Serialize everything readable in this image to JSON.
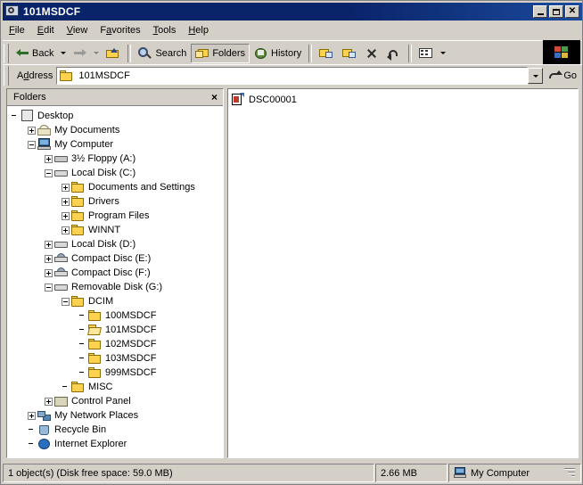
{
  "window": {
    "title": "101MSDCF",
    "title_icon": "folder-search-icon",
    "minimize_label": "Minimize",
    "maximize_label": "Maximize",
    "close_label": "Close"
  },
  "menubar": {
    "items": [
      {
        "label": "File",
        "accel": "F"
      },
      {
        "label": "Edit",
        "accel": "E"
      },
      {
        "label": "View",
        "accel": "V"
      },
      {
        "label": "Favorites",
        "accel": "a"
      },
      {
        "label": "Tools",
        "accel": "T"
      },
      {
        "label": "Help",
        "accel": "H"
      }
    ]
  },
  "toolbar": {
    "back_label": "Back",
    "forward_label": "Forward",
    "up_label": "Up",
    "search_label": "Search",
    "folders_label": "Folders",
    "history_label": "History",
    "move_to_label": "Move To",
    "copy_to_label": "Copy To",
    "delete_label": "Delete",
    "undo_label": "Undo",
    "views_label": "Views"
  },
  "address": {
    "label": "Address",
    "value": "101MSDCF",
    "icon": "folder-icon",
    "go_label": "Go"
  },
  "folders_pane": {
    "title": "Folders",
    "close_label": "×",
    "tree": [
      {
        "label": "Desktop",
        "indent": 0,
        "expander": "none",
        "icon": "desktop-icon"
      },
      {
        "label": "My Documents",
        "indent": 1,
        "expander": "plus",
        "icon": "my-documents-icon"
      },
      {
        "label": "My Computer",
        "indent": 1,
        "expander": "minus",
        "icon": "my-computer-icon"
      },
      {
        "label": "3½ Floppy (A:)",
        "indent": 2,
        "expander": "plus",
        "icon": "floppy-drive-icon"
      },
      {
        "label": "Local Disk (C:)",
        "indent": 2,
        "expander": "minus",
        "icon": "hard-drive-icon"
      },
      {
        "label": "Documents and Settings",
        "indent": 3,
        "expander": "plus",
        "icon": "folder-icon"
      },
      {
        "label": "Drivers",
        "indent": 3,
        "expander": "plus",
        "icon": "folder-icon"
      },
      {
        "label": "Program Files",
        "indent": 3,
        "expander": "plus",
        "icon": "folder-icon"
      },
      {
        "label": "WINNT",
        "indent": 3,
        "expander": "plus",
        "icon": "folder-icon"
      },
      {
        "label": "Local Disk (D:)",
        "indent": 2,
        "expander": "plus",
        "icon": "hard-drive-icon"
      },
      {
        "label": "Compact Disc (E:)",
        "indent": 2,
        "expander": "plus",
        "icon": "cd-drive-icon"
      },
      {
        "label": "Compact Disc (F:)",
        "indent": 2,
        "expander": "plus",
        "icon": "cd-drive-icon"
      },
      {
        "label": "Removable Disk (G:)",
        "indent": 2,
        "expander": "minus",
        "icon": "removable-drive-icon"
      },
      {
        "label": "DCIM",
        "indent": 3,
        "expander": "minus",
        "icon": "folder-icon"
      },
      {
        "label": "100MSDCF",
        "indent": 4,
        "expander": "none",
        "icon": "folder-icon"
      },
      {
        "label": "101MSDCF",
        "indent": 4,
        "expander": "none",
        "icon": "folder-open-icon"
      },
      {
        "label": "102MSDCF",
        "indent": 4,
        "expander": "none",
        "icon": "folder-icon"
      },
      {
        "label": "103MSDCF",
        "indent": 4,
        "expander": "none",
        "icon": "folder-icon"
      },
      {
        "label": "999MSDCF",
        "indent": 4,
        "expander": "none",
        "icon": "folder-icon"
      },
      {
        "label": "MISC",
        "indent": 3,
        "expander": "none",
        "icon": "folder-icon"
      },
      {
        "label": "Control Panel",
        "indent": 2,
        "expander": "plus",
        "icon": "control-panel-icon"
      },
      {
        "label": "My Network Places",
        "indent": 1,
        "expander": "plus",
        "icon": "network-places-icon"
      },
      {
        "label": "Recycle Bin",
        "indent": 1,
        "expander": "none",
        "icon": "recycle-bin-icon"
      },
      {
        "label": "Internet Explorer",
        "indent": 1,
        "expander": "none",
        "icon": "internet-explorer-icon"
      }
    ]
  },
  "list_pane": {
    "items": [
      {
        "label": "DSC00001",
        "icon": "image-file-icon"
      }
    ]
  },
  "statusbar": {
    "objects_text": "1 object(s) (Disk free space: 59.0 MB)",
    "size_text": "2.66 MB",
    "zone_text": "My Computer",
    "zone_icon": "my-computer-icon"
  },
  "colors": {
    "titlebar": "#0a246a",
    "chrome": "#d4d0c8",
    "pane_bg": "#ffffff",
    "folder_yellow": "#ffd24d"
  }
}
